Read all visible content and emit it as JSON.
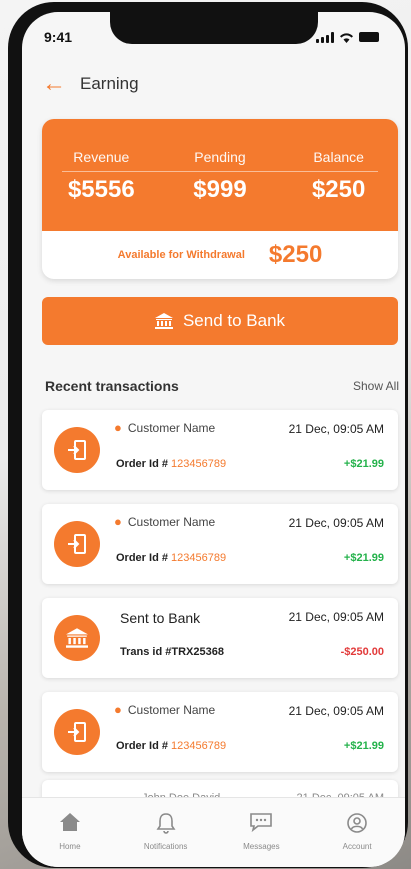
{
  "status_bar": {
    "time": "9:41"
  },
  "header": {
    "title": "Earning"
  },
  "summary": {
    "stats": [
      {
        "label": "Revenue",
        "value": "$5556"
      },
      {
        "label": "Pending",
        "value": "$999"
      },
      {
        "label": "Balance",
        "value": "$250"
      }
    ],
    "withdraw_label": "Available for Withdrawal",
    "withdraw_value": "$250"
  },
  "send_button": {
    "label": "Send to Bank"
  },
  "transactions_section": {
    "title": "Recent transactions",
    "show_all": "Show All"
  },
  "transactions": [
    {
      "name": "Customer Name",
      "date": "21 Dec, 09:05 AM",
      "ref_label": "Order Id # ",
      "ref_value": "123456789",
      "amount": "+$21.99"
    },
    {
      "name": "Customer Name",
      "date": "21 Dec, 09:05 AM",
      "ref_label": "Order Id # ",
      "ref_value": "123456789",
      "amount": "+$21.99"
    },
    {
      "name": "Sent to Bank",
      "date": "21 Dec, 09:05 AM",
      "ref_label": "Trans id #TRX25368",
      "ref_value": "",
      "amount": "-$250.00"
    },
    {
      "name": "Customer Name",
      "date": "21 Dec, 09:05 AM",
      "ref_label": "Order Id # ",
      "ref_value": "123456789",
      "amount": "+$21.99"
    },
    {
      "name": "John Doe David",
      "date": "21 Dec, 09:05 AM"
    }
  ],
  "tabs": [
    {
      "label": "Home",
      "icon": "home-icon"
    },
    {
      "label": "Notifications",
      "icon": "bell-icon"
    },
    {
      "label": "Messages",
      "icon": "chat-icon"
    },
    {
      "label": "Account",
      "icon": "user-icon"
    }
  ],
  "colors": {
    "accent": "#f47a2e",
    "positive": "#24b24b",
    "negative": "#e23a3a"
  }
}
